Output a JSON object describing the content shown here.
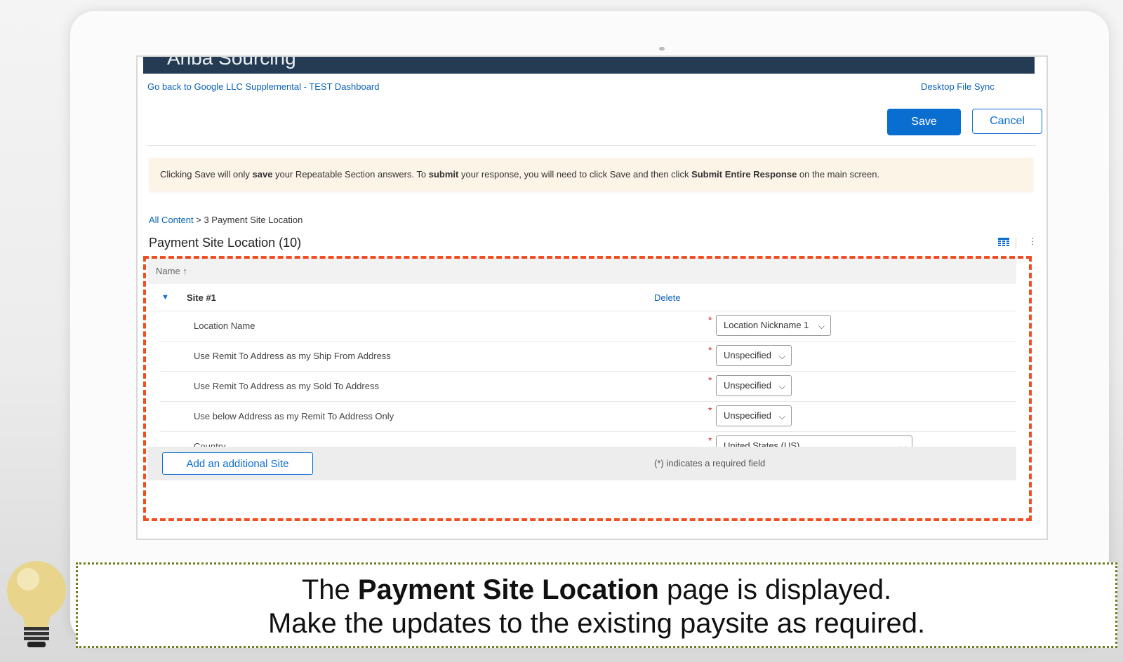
{
  "app": {
    "header_title": "Ariba Sourcing"
  },
  "nav": {
    "back_link": "Go back to Google LLC Supplemental - TEST Dashboard",
    "desktop_sync": "Desktop File Sync"
  },
  "toolbar": {
    "save_label": "Save",
    "cancel_label": "Cancel"
  },
  "notice": {
    "t1": "Clicking Save will only ",
    "b1": "save",
    "t2": " your Repeatable Section answers. To ",
    "b2": "submit",
    "t3": " your response, you will need to click Save and then click ",
    "b3": "Submit Entire Response",
    "t4": " on the main screen."
  },
  "breadcrumb": {
    "root": "All Content",
    "separator": ">",
    "current": "3 Payment Site Location"
  },
  "page": {
    "title": "Payment Site Location (10)"
  },
  "table": {
    "header_name": "Name",
    "sort_icon": "↑",
    "site_label": "Site #1",
    "delete_label": "Delete",
    "fields": [
      {
        "label": "Location Name",
        "value": "Location Nickname 1"
      },
      {
        "label": "Use Remit To Address as my Ship From Address",
        "value": "Unspecified"
      },
      {
        "label": "Use Remit To Address as my Sold To Address",
        "value": "Unspecified"
      },
      {
        "label": "Use below Address as my Remit To Address Only",
        "value": "Unspecified"
      },
      {
        "label": "Country",
        "value": "United States (US)"
      }
    ],
    "required_marker": "*",
    "add_button_label": "Add an additional Site",
    "required_note": "(*) indicates a required field"
  },
  "caption": {
    "line1_pre": "The ",
    "line1_bold": "Payment Site Location",
    "line1_post": " page is displayed.",
    "line2": "Make the updates to the existing paysite as required."
  },
  "colors": {
    "primary": "#0a6ed1",
    "highlight_dash": "#f04e23",
    "caption_border": "#6b7d1e",
    "topbar": "#243b53"
  }
}
